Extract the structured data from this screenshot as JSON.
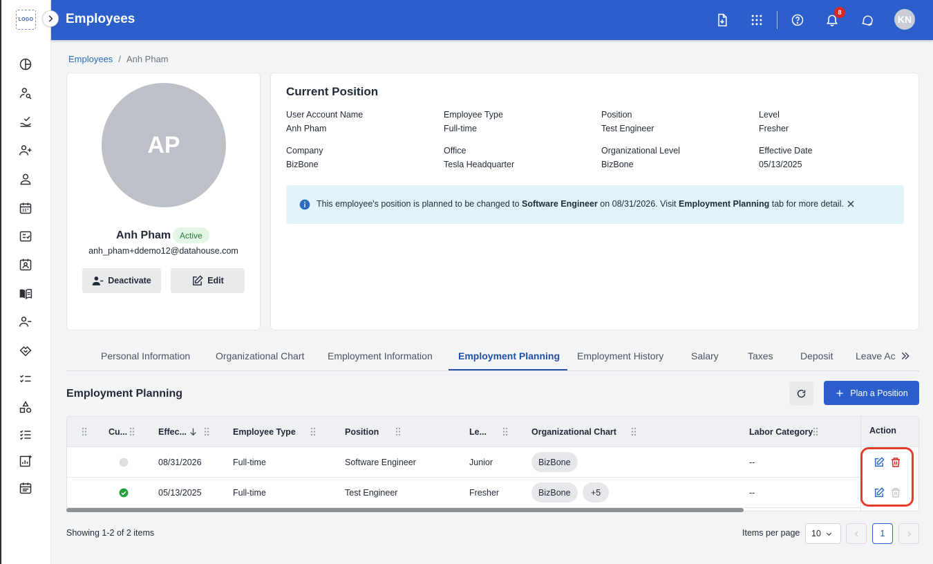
{
  "app": {
    "logo_text": "LOGO",
    "page_title": "Employees",
    "notification_count": "8",
    "user_initials": "KN"
  },
  "breadcrumb": {
    "parent": "Employees",
    "separator": "/",
    "current": "Anh Pham"
  },
  "profile": {
    "initials": "AP",
    "name": "Anh Pham",
    "status": "Active",
    "email": "anh_pham+ddemo12@datahouse.com",
    "deactivate_label": "Deactivate",
    "edit_label": "Edit"
  },
  "current_position": {
    "title": "Current Position",
    "fields": [
      {
        "label": "User Account Name",
        "value": "Anh Pham"
      },
      {
        "label": "Employee Type",
        "value": "Full-time"
      },
      {
        "label": "Position",
        "value": "Test Engineer"
      },
      {
        "label": "Level",
        "value": "Fresher"
      },
      {
        "label": "Company",
        "value": "BizBone"
      },
      {
        "label": "Office",
        "value": "Tesla Headquarter"
      },
      {
        "label": "Organizational Level",
        "value": "BizBone"
      },
      {
        "label": "Effective Date",
        "value": "05/13/2025"
      }
    ],
    "banner": {
      "prefix": "This employee's position is planned to be changed to ",
      "new_position": "Software Engineer",
      "middle": " on 08/31/2026. Visit ",
      "tab_name": "Employment Planning",
      "suffix": " tab for more detail."
    }
  },
  "tabs": [
    {
      "label": "Personal Information"
    },
    {
      "label": "Organizational Chart"
    },
    {
      "label": "Employment Information"
    },
    {
      "label": "Employment Planning",
      "active": true
    },
    {
      "label": "Employment History"
    },
    {
      "label": "Salary"
    },
    {
      "label": "Taxes"
    },
    {
      "label": "Deposit"
    },
    {
      "label": "Leave Ac"
    }
  ],
  "planning": {
    "title": "Employment Planning",
    "plan_button": "Plan a Position",
    "columns": {
      "current": "Cu...",
      "effective": "Effec...",
      "employee_type": "Employee Type",
      "position": "Position",
      "level": "Le...",
      "org_chart": "Organizational Chart",
      "labor_category": "Labor Category",
      "action": "Action"
    },
    "rows": [
      {
        "current": false,
        "effective": "08/31/2026",
        "employee_type": "Full-time",
        "position": "Software Engineer",
        "level": "Junior",
        "org_chart": "BizBone",
        "extra": "",
        "labor_category": "--"
      },
      {
        "current": true,
        "effective": "05/13/2025",
        "employee_type": "Full-time",
        "position": "Test Engineer",
        "level": "Fresher",
        "org_chart": "BizBone",
        "extra": "+5",
        "labor_category": "--"
      }
    ]
  },
  "footer": {
    "showing": "Showing 1-2 of 2 items",
    "items_per_page_label": "Items per page",
    "items_per_page": "10",
    "current_page": "1"
  },
  "colors": {
    "brand_blue": "#2c5fcb",
    "active_tab": "#1e50a8",
    "danger": "#dc2626",
    "success": "#22a03a",
    "highlight": "#e53b2c"
  }
}
